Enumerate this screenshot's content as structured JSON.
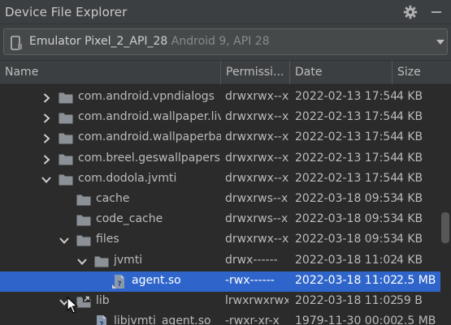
{
  "panel": {
    "title": "Device File Explorer"
  },
  "device": {
    "name": "Emulator Pixel_2_API_28",
    "detail": "Android 9, API 28"
  },
  "columns": {
    "name": "Name",
    "permissions": "Permissi...",
    "date": "Date",
    "size": "Size"
  },
  "rows": [
    {
      "name": "com.android.vpndialogs",
      "perm": "drwxrwx--x",
      "date": "2022-02-13 17:54",
      "size": "4 KB",
      "type": "folder",
      "expanded": false
    },
    {
      "name": "com.android.wallpaper.liv",
      "perm": "drwxrwx--x",
      "date": "2022-02-13 17:54",
      "size": "4 KB",
      "type": "folder",
      "expanded": false
    },
    {
      "name": "com.android.wallpaperba",
      "perm": "drwxrwx--x",
      "date": "2022-02-13 17:54",
      "size": "4 KB",
      "type": "folder",
      "expanded": false
    },
    {
      "name": "com.breel.geswallpapers",
      "perm": "drwxrwx--x",
      "date": "2022-02-13 17:54",
      "size": "4 KB",
      "type": "folder",
      "expanded": false
    },
    {
      "name": "com.dodola.jvmti",
      "perm": "drwxrwx--x",
      "date": "2022-02-13 17:54",
      "size": "4 KB",
      "type": "folder",
      "expanded": true
    },
    {
      "name": "cache",
      "perm": "drwxrws--x",
      "date": "2022-03-18 09:53",
      "size": "4 KB",
      "type": "folder"
    },
    {
      "name": "code_cache",
      "perm": "drwxrws--x",
      "date": "2022-03-18 09:53",
      "size": "4 KB",
      "type": "folder"
    },
    {
      "name": "files",
      "perm": "drwxrwx--x",
      "date": "2022-03-18 09:53",
      "size": "4 KB",
      "type": "folder",
      "expanded": true
    },
    {
      "name": "jvmti",
      "perm": "drwx------",
      "date": "2022-03-18 11:02",
      "size": "4 KB",
      "type": "folder",
      "expanded": true
    },
    {
      "name": "agent.so",
      "perm": "-rwx------",
      "date": "2022-03-18 11:02",
      "size": "2.5 MB",
      "type": "file",
      "selected": true
    },
    {
      "name": "lib",
      "perm": "lrwxrwxrwx",
      "date": "2022-03-18 11:02",
      "size": "59 B",
      "type": "link-folder",
      "expanded": true
    },
    {
      "name": "libjvmti_agent.so",
      "perm": "-rwxr-xr-x",
      "date": "1979-11-30 00:00",
      "size": "2.5 MB",
      "type": "file"
    }
  ],
  "colors": {
    "background": "#2b2b2b",
    "toolbar": "#3c3f41",
    "selection": "#2f65ca",
    "folder": "#8b9196",
    "text": "#bbbbbb"
  }
}
